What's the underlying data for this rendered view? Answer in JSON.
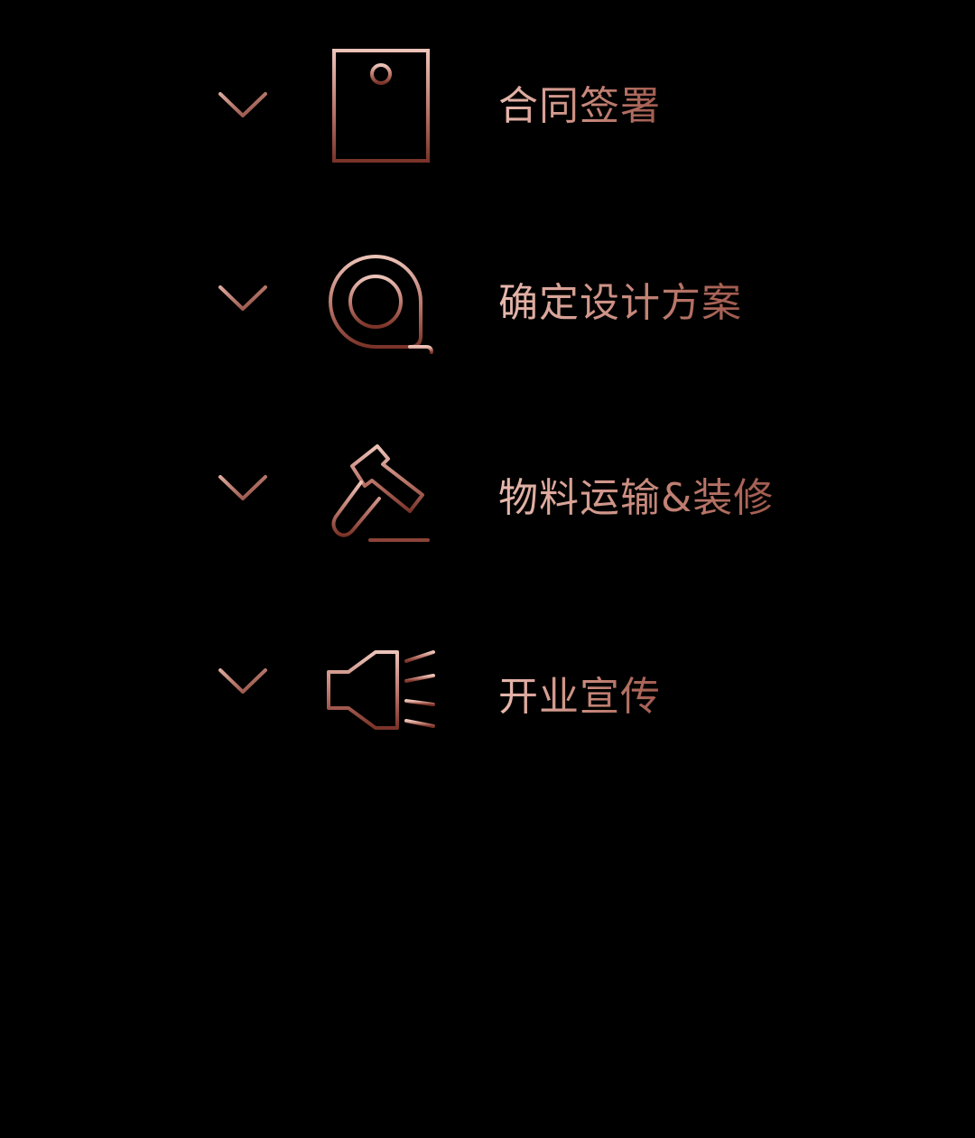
{
  "colors": {
    "background": "#000000",
    "accent_light": "#e7b9ae",
    "accent_mid": "#c7887b",
    "accent_dark": "#7a3328"
  },
  "steps": [
    {
      "label": "合同签署",
      "icon": "envelope-seal-icon"
    },
    {
      "label": "确定设计方案",
      "icon": "tape-measure-icon"
    },
    {
      "label": "物料运输&装修",
      "icon": "hammer-icon"
    },
    {
      "label": "开业宣传",
      "icon": "megaphone-icon"
    }
  ]
}
